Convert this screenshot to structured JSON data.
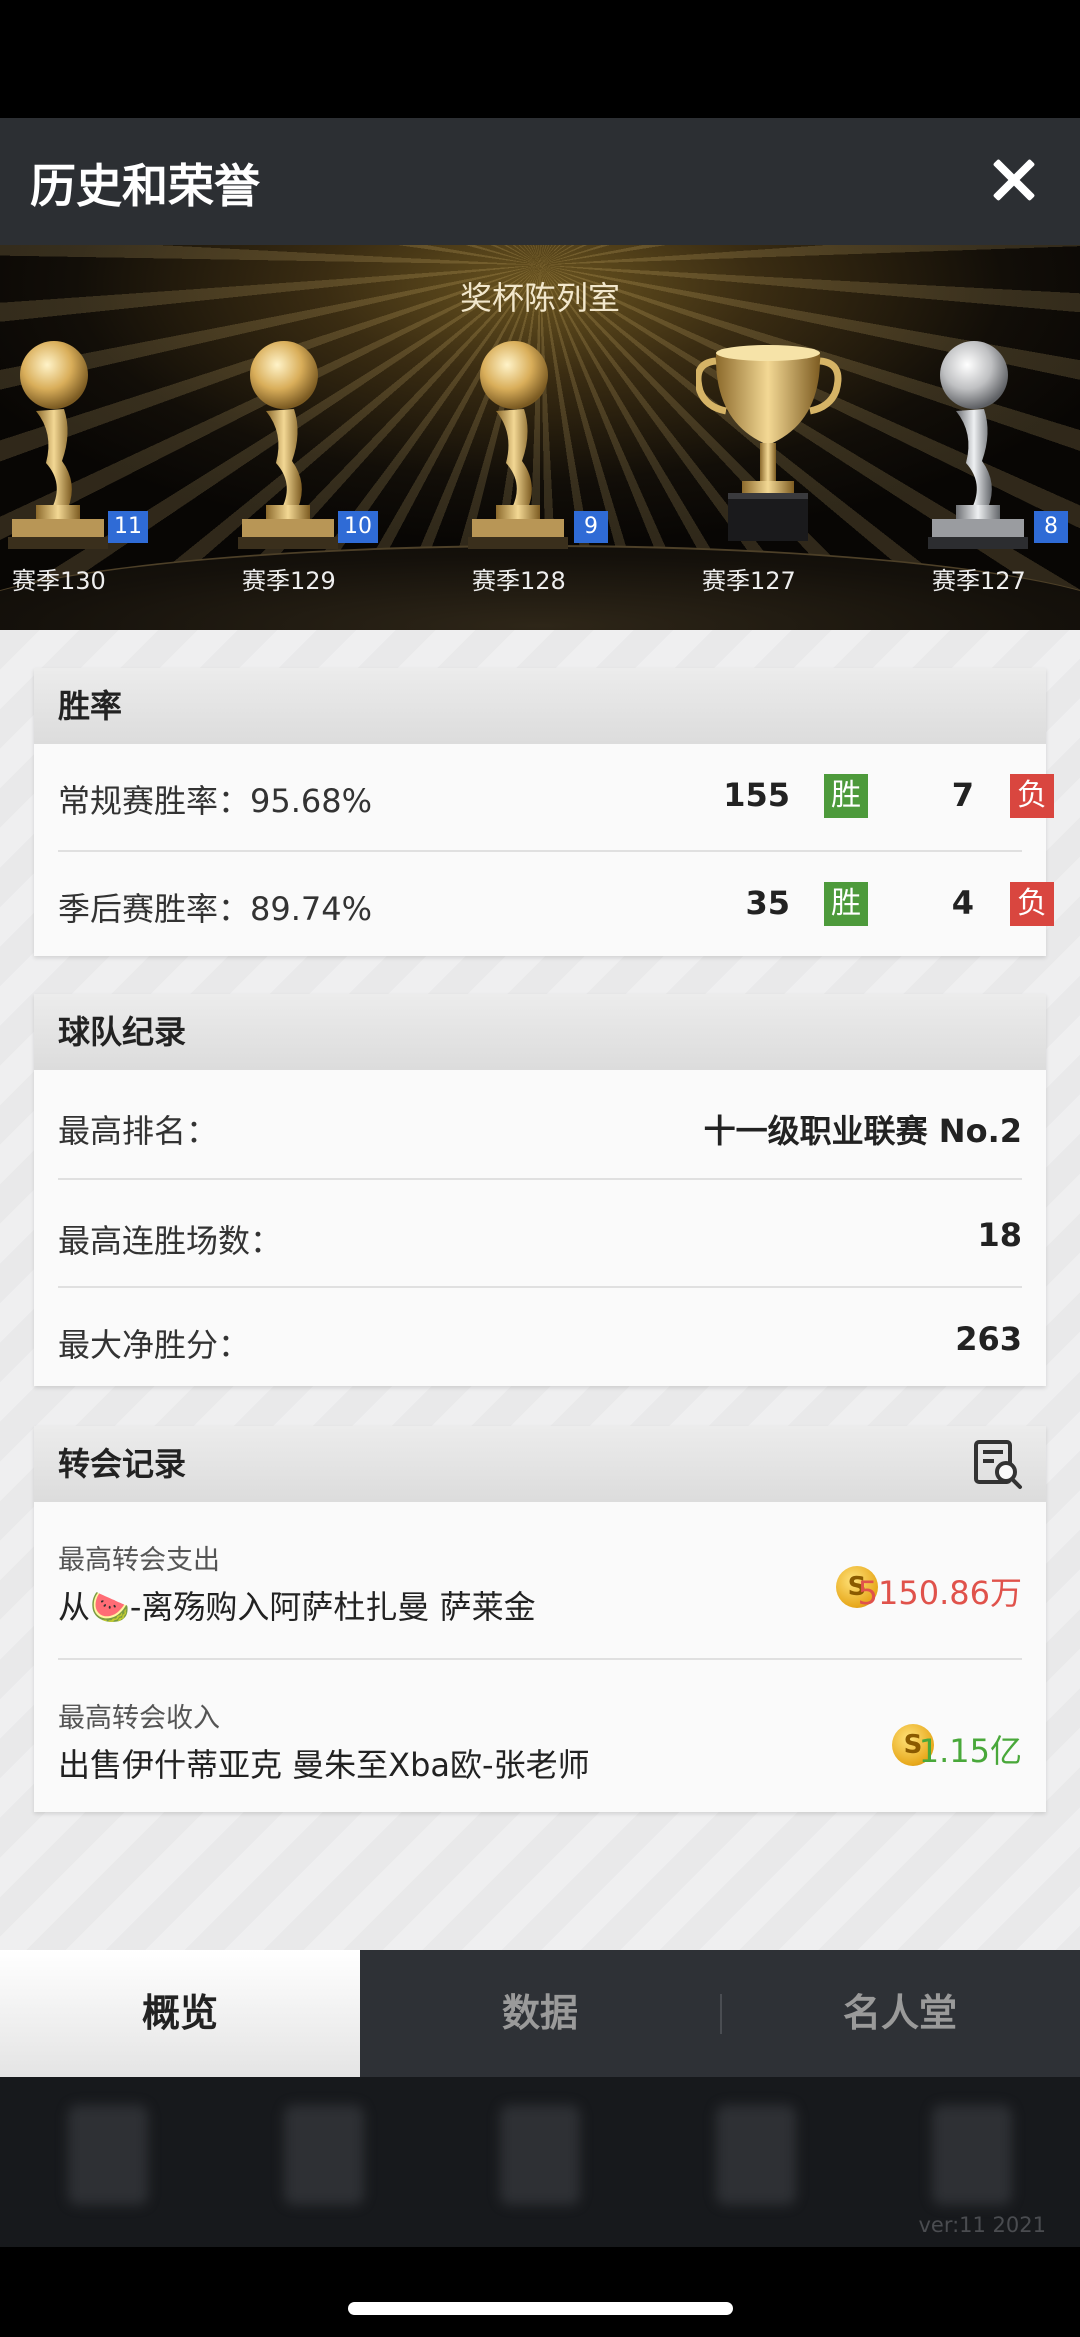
{
  "header": {
    "title": "历史和荣誉"
  },
  "trophy_room": {
    "title": "奖杯陈列室",
    "trophies": [
      {
        "season": "赛季130",
        "badge": "11",
        "kind": "gold-ball"
      },
      {
        "season": "赛季129",
        "badge": "10",
        "kind": "gold-ball"
      },
      {
        "season": "赛季128",
        "badge": "9",
        "kind": "gold-ball"
      },
      {
        "season": "赛季127",
        "badge": "",
        "kind": "gold-cup"
      },
      {
        "season": "赛季127",
        "badge": "8",
        "kind": "silver-ball"
      }
    ]
  },
  "win_rate": {
    "title": "胜率",
    "rows": [
      {
        "label": "常规赛胜率：95.68%",
        "wins": "155",
        "win_tag": "胜",
        "losses": "7",
        "loss_tag": "负"
      },
      {
        "label": "季后赛胜率：89.74%",
        "wins": "35",
        "win_tag": "胜",
        "losses": "4",
        "loss_tag": "负"
      }
    ]
  },
  "team_record": {
    "title": "球队纪录",
    "rows": [
      {
        "label": "最高排名：",
        "value": "十一级职业联赛 No.2"
      },
      {
        "label": "最高连胜场数：",
        "value": "18"
      },
      {
        "label": "最大净胜分：",
        "value": "263"
      }
    ]
  },
  "transfer_record": {
    "title": "转会记录",
    "rows": [
      {
        "caption": "最高转会支出",
        "desc": "从🍉-离殇购入阿萨杜扎曼 萨莱金",
        "amount": "5150.86万",
        "color": "#e0524b"
      },
      {
        "caption": "最高转会收入",
        "desc": "出售伊什蒂亚克 曼朱至Xba欧-张老师",
        "amount": "1.15亿",
        "color": "#49a83a"
      }
    ],
    "coin_symbol": "S"
  },
  "tabs": [
    {
      "label": "概览",
      "active": true
    },
    {
      "label": "数据",
      "active": false
    },
    {
      "label": "名人堂",
      "active": false
    }
  ],
  "version": "ver:11  2021",
  "colors": {
    "header": "#2c2f33",
    "win": "#4d9a3b",
    "loss": "#d9463f",
    "badge": "#2f6bd6"
  },
  "icons": [
    "close-icon",
    "trophy-gold-ball-icon",
    "trophy-gold-cup-icon",
    "trophy-silver-ball-icon",
    "search-document-icon",
    "coin-icon"
  ]
}
